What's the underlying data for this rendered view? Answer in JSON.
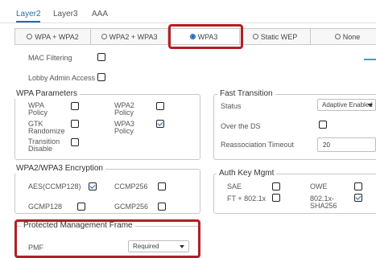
{
  "tabs": [
    {
      "label": "Layer2",
      "active": true
    },
    {
      "label": "Layer3",
      "active": false
    },
    {
      "label": "AAA",
      "active": false
    }
  ],
  "security_types": [
    {
      "label": "WPA + WPA2",
      "selected": false
    },
    {
      "label": "WPA2 + WPA3",
      "selected": false
    },
    {
      "label": "WPA3",
      "selected": true
    },
    {
      "label": "Static WEP",
      "selected": false
    },
    {
      "label": "None",
      "selected": false
    }
  ],
  "mac_filtering": {
    "label": "MAC Filtering",
    "checked": false
  },
  "lobby_admin": {
    "label": "Lobby Admin Access",
    "checked": false
  },
  "wpa_parameters": {
    "title": "WPA Parameters",
    "items": [
      {
        "label": "WPA\nPolicy",
        "checked": false
      },
      {
        "label": "WPA2\nPolicy",
        "checked": false
      },
      {
        "label": "GTK\nRandomize",
        "checked": false
      },
      {
        "label": "WPA3\nPolicy",
        "checked": true
      },
      {
        "label": "Transition\nDisable",
        "checked": false
      }
    ]
  },
  "encryption": {
    "title": "WPA2/WPA3 Encryption",
    "items": [
      {
        "label": "AES(CCMP128)",
        "checked": true
      },
      {
        "label": "CCMP256",
        "checked": false
      },
      {
        "label": "GCMP128",
        "checked": false
      },
      {
        "label": "GCMP256",
        "checked": false
      }
    ]
  },
  "pmf": {
    "title": "Protected Management Frame",
    "label": "PMF",
    "value": "Required"
  },
  "fast_transition": {
    "title": "Fast Transition",
    "status_label": "Status",
    "status_value": "Adaptive Enabled",
    "over_ds_label": "Over the DS",
    "over_ds_checked": false,
    "reassoc_label": "Reassociation Timeout",
    "reassoc_value": "20"
  },
  "auth_key": {
    "title": "Auth Key Mgmt",
    "items": [
      {
        "label": "SAE",
        "checked": false
      },
      {
        "label": "OWE",
        "checked": false
      },
      {
        "label": "FT + 802.1x",
        "checked": false
      },
      {
        "label": "802.1x-\nSHA256",
        "checked": true
      }
    ]
  },
  "colors": {
    "accent": "#1e6bb8",
    "highlight": "#b21f24"
  }
}
